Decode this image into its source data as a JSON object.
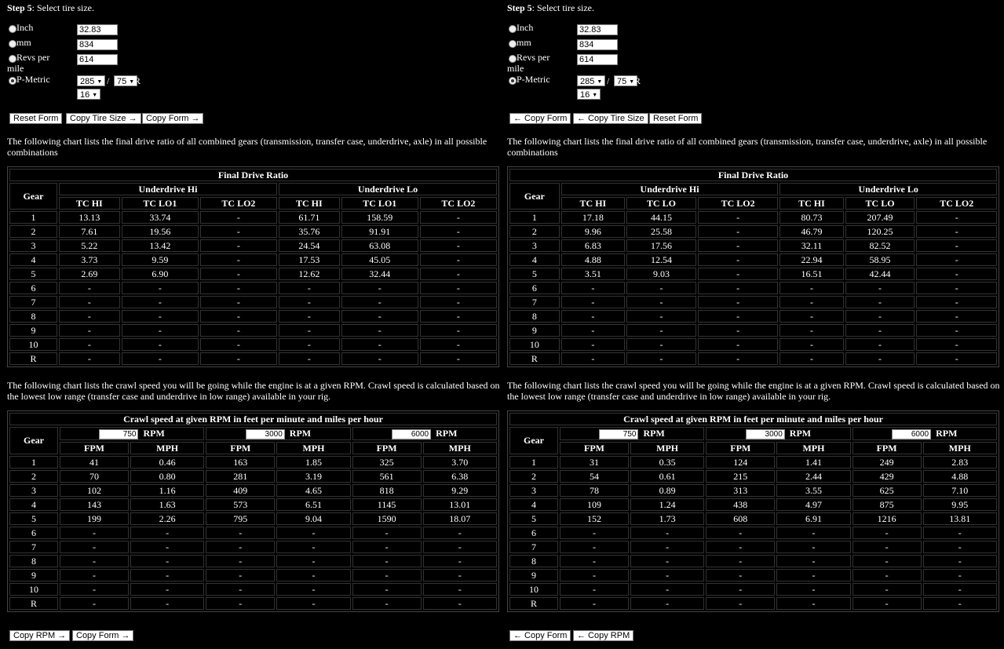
{
  "left": {
    "step_label": "Step 5",
    "step_text": ": Select tire size.",
    "tire": {
      "inch_label": "Inch",
      "inch_value": "32.83",
      "mm_label": "mm",
      "mm_value": "834",
      "revs_label_1": "Revs per",
      "revs_label_2": "mile",
      "revs_value": "614",
      "pmetric_label": "P-Metric",
      "width": "285",
      "slash": "/",
      "aspect": "75",
      "r": "R",
      "rim": "16"
    },
    "buttons": [
      "Reset Form",
      "Copy Tire Size →",
      "Copy Form →"
    ],
    "ratio_intro": "The following chart lists the final drive ratio of all combined gears (transmission, transfer case, underdrive, axle) in all possible combinations",
    "ratio": {
      "title": "Final Drive Ratio",
      "gear_header": "Gear",
      "group1": "Underdrive Hi",
      "group2": "Underdrive Lo",
      "cols": [
        "TC HI",
        "TC LO1",
        "TC LO2",
        "TC HI",
        "TC LO1",
        "TC LO2"
      ],
      "rows": [
        [
          "1",
          "13.13",
          "33.74",
          "-",
          "61.71",
          "158.59",
          "-"
        ],
        [
          "2",
          "7.61",
          "19.56",
          "-",
          "35.76",
          "91.91",
          "-"
        ],
        [
          "3",
          "5.22",
          "13.42",
          "-",
          "24.54",
          "63.08",
          "-"
        ],
        [
          "4",
          "3.73",
          "9.59",
          "-",
          "17.53",
          "45.05",
          "-"
        ],
        [
          "5",
          "2.69",
          "6.90",
          "-",
          "12.62",
          "32.44",
          "-"
        ],
        [
          "6",
          "-",
          "-",
          "-",
          "-",
          "-",
          "-"
        ],
        [
          "7",
          "-",
          "-",
          "-",
          "-",
          "-",
          "-"
        ],
        [
          "8",
          "-",
          "-",
          "-",
          "-",
          "-",
          "-"
        ],
        [
          "9",
          "-",
          "-",
          "-",
          "-",
          "-",
          "-"
        ],
        [
          "10",
          "-",
          "-",
          "-",
          "-",
          "-",
          "-"
        ],
        [
          "R",
          "-",
          "-",
          "-",
          "-",
          "-",
          "-"
        ]
      ]
    },
    "crawl_intro": "The following chart lists the crawl speed you will be going while the engine is at a given RPM. Crawl speed is calculated based on the lowest low range (transfer case and underdrive in low range) available in your rig.",
    "crawl": {
      "title": "Crawl speed at given RPM in feet per minute and miles per hour",
      "gear_header": "Gear",
      "rpm_label": "RPM",
      "rpm_values": [
        "750",
        "3000",
        "6000"
      ],
      "cols": [
        "FPM",
        "MPH",
        "FPM",
        "MPH",
        "FPM",
        "MPH"
      ],
      "rows": [
        [
          "1",
          "41",
          "0.46",
          "163",
          "1.85",
          "325",
          "3.70"
        ],
        [
          "2",
          "70",
          "0.80",
          "281",
          "3.19",
          "561",
          "6.38"
        ],
        [
          "3",
          "102",
          "1.16",
          "409",
          "4.65",
          "818",
          "9.29"
        ],
        [
          "4",
          "143",
          "1.63",
          "573",
          "6.51",
          "1145",
          "13.01"
        ],
        [
          "5",
          "199",
          "2.26",
          "795",
          "9.04",
          "1590",
          "18.07"
        ],
        [
          "6",
          "-",
          "-",
          "-",
          "-",
          "-",
          "-"
        ],
        [
          "7",
          "-",
          "-",
          "-",
          "-",
          "-",
          "-"
        ],
        [
          "8",
          "-",
          "-",
          "-",
          "-",
          "-",
          "-"
        ],
        [
          "9",
          "-",
          "-",
          "-",
          "-",
          "-",
          "-"
        ],
        [
          "10",
          "-",
          "-",
          "-",
          "-",
          "-",
          "-"
        ],
        [
          "R",
          "-",
          "-",
          "-",
          "-",
          "-",
          "-"
        ]
      ]
    },
    "bottom_buttons": [
      "Copy RPM →",
      "Copy Form →"
    ]
  },
  "right": {
    "step_label": "Step 5",
    "step_text": ": Select tire size.",
    "tire": {
      "inch_label": "Inch",
      "inch_value": "32.83",
      "mm_label": "mm",
      "mm_value": "834",
      "revs_label_1": "Revs per",
      "revs_label_2": "mile",
      "revs_value": "614",
      "pmetric_label": "P-Metric",
      "width": "285",
      "slash": "/",
      "aspect": "75",
      "r": "R",
      "rim": "16"
    },
    "buttons": [
      "← Copy Form",
      "← Copy Tire Size",
      "Reset Form"
    ],
    "ratio_intro": "The following chart lists the final drive ratio of all combined gears (transmission, transfer case, underdrive, axle) in all possible combinations",
    "ratio": {
      "title": "Final Drive Ratio",
      "gear_header": "Gear",
      "group1": "Underdrive Hi",
      "group2": "Underdrive Lo",
      "cols": [
        "TC HI",
        "TC LO",
        "TC LO2",
        "TC HI",
        "TC LO",
        "TC LO2"
      ],
      "rows": [
        [
          "1",
          "17.18",
          "44.15",
          "-",
          "80.73",
          "207.49",
          "-"
        ],
        [
          "2",
          "9.96",
          "25.58",
          "-",
          "46.79",
          "120.25",
          "-"
        ],
        [
          "3",
          "6.83",
          "17.56",
          "-",
          "32.11",
          "82.52",
          "-"
        ],
        [
          "4",
          "4.88",
          "12.54",
          "-",
          "22.94",
          "58.95",
          "-"
        ],
        [
          "5",
          "3.51",
          "9.03",
          "-",
          "16.51",
          "42.44",
          "-"
        ],
        [
          "6",
          "-",
          "-",
          "-",
          "-",
          "-",
          "-"
        ],
        [
          "7",
          "-",
          "-",
          "-",
          "-",
          "-",
          "-"
        ],
        [
          "8",
          "-",
          "-",
          "-",
          "-",
          "-",
          "-"
        ],
        [
          "9",
          "-",
          "-",
          "-",
          "-",
          "-",
          "-"
        ],
        [
          "10",
          "-",
          "-",
          "-",
          "-",
          "-",
          "-"
        ],
        [
          "R",
          "-",
          "-",
          "-",
          "-",
          "-",
          "-"
        ]
      ]
    },
    "crawl_intro": "The following chart lists the crawl speed you will be going while the engine is at a given RPM. Crawl speed is calculated based on the lowest low range (transfer case and underdrive in low range) available in your rig.",
    "crawl": {
      "title": "Crawl speed at given RPM in feet per minute and miles per hour",
      "gear_header": "Gear",
      "rpm_label": "RPM",
      "rpm_values": [
        "750",
        "3000",
        "6000"
      ],
      "cols": [
        "FPM",
        "MPH",
        "FPM",
        "MPH",
        "FPM",
        "MPH"
      ],
      "rows": [
        [
          "1",
          "31",
          "0.35",
          "124",
          "1.41",
          "249",
          "2.83"
        ],
        [
          "2",
          "54",
          "0.61",
          "215",
          "2.44",
          "429",
          "4.88"
        ],
        [
          "3",
          "78",
          "0.89",
          "313",
          "3.55",
          "625",
          "7.10"
        ],
        [
          "4",
          "109",
          "1.24",
          "438",
          "4.97",
          "875",
          "9.95"
        ],
        [
          "5",
          "152",
          "1.73",
          "608",
          "6.91",
          "1216",
          "13.81"
        ],
        [
          "6",
          "-",
          "-",
          "-",
          "-",
          "-",
          "-"
        ],
        [
          "7",
          "-",
          "-",
          "-",
          "-",
          "-",
          "-"
        ],
        [
          "8",
          "-",
          "-",
          "-",
          "-",
          "-",
          "-"
        ],
        [
          "9",
          "-",
          "-",
          "-",
          "-",
          "-",
          "-"
        ],
        [
          "10",
          "-",
          "-",
          "-",
          "-",
          "-",
          "-"
        ],
        [
          "R",
          "-",
          "-",
          "-",
          "-",
          "-",
          "-"
        ]
      ]
    },
    "bottom_buttons": [
      "← Copy Form",
      "← Copy RPM"
    ]
  }
}
